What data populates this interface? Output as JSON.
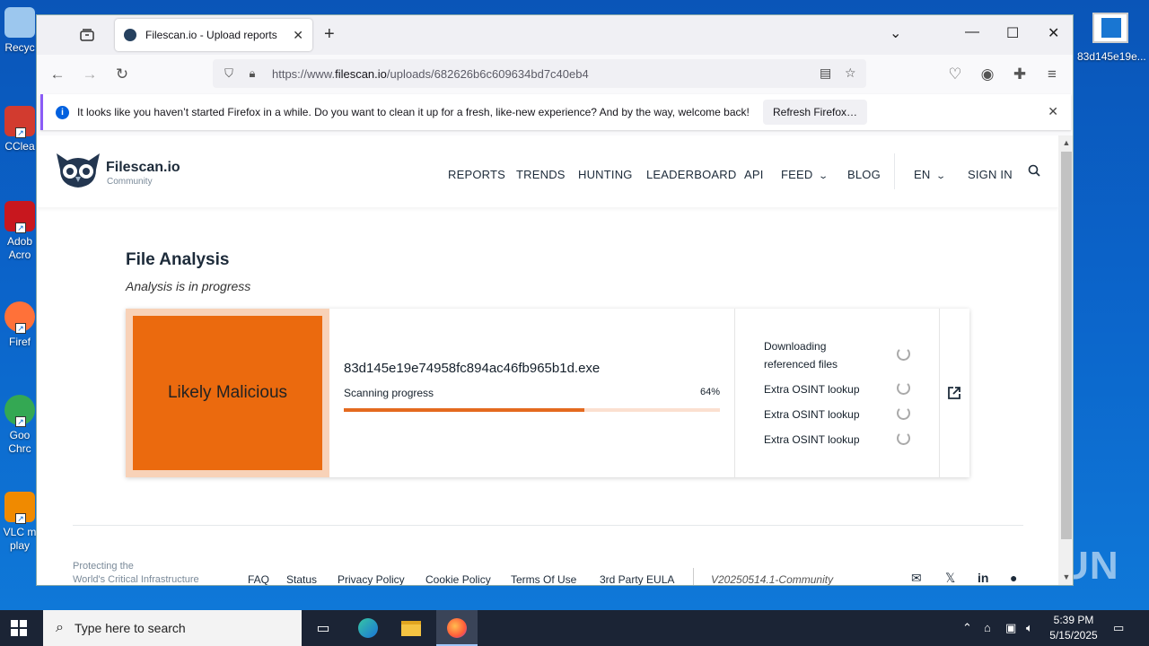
{
  "desktop": {
    "icons": [
      {
        "label": "Recyc",
        "color": "#9cc7ee"
      },
      {
        "label": "CClea",
        "color": "#d23b2f"
      },
      {
        "label": "Adob Acro",
        "color": "#c8171e"
      },
      {
        "label": "Firef",
        "color": "#ff7139"
      },
      {
        "label": "Goo Chrc",
        "color": "#34a853"
      },
      {
        "label": "VLC m play",
        "color": "#f08a00"
      }
    ],
    "right_icon_label": "83d145e19e..."
  },
  "browser": {
    "tab_title": "Filescan.io - Upload reports",
    "url_prefix": "https://www.",
    "url_domain": "filescan.io",
    "url_path": "/uploads/682626b6c609634bd7c40eb4",
    "notice_text": "It looks like you haven’t started Firefox in a while. Do you want to clean it up for a fresh, like-new experience? And by the way, welcome back!",
    "notice_button": "Refresh Firefox…"
  },
  "site": {
    "brand": "Filescan.io",
    "brand_sub": "Community",
    "menu": [
      "REPORTS",
      "TRENDS",
      "HUNTING",
      "LEADERBOARD",
      "API",
      "FEED",
      "BLOG"
    ],
    "lang": "EN",
    "signin": "SIGN IN"
  },
  "analysis": {
    "title": "File Analysis",
    "subtitle": "Analysis is in progress",
    "verdict": "Likely Malicious",
    "verdict_color": "#eb6a0e",
    "file_name": "83d145e19e74958fc894ac46fb965b1d.exe",
    "progress_label": "Scanning progress",
    "progress_text": "64%",
    "progress_value": 0.64,
    "tasks": [
      {
        "line1": "Downloading",
        "line2": "referenced files"
      },
      {
        "line1": "Extra OSINT lookup"
      },
      {
        "line1": "Extra OSINT lookup"
      },
      {
        "line1": "Extra OSINT lookup"
      }
    ]
  },
  "footer": {
    "tagline_1": "Protecting the",
    "tagline_2": "World's Critical Infrastructure",
    "links": [
      "FAQ",
      "Status",
      "Privacy Policy",
      "Cookie Policy",
      "Terms Of Use",
      "3rd Party EULA"
    ],
    "version": "V20250514.1-Community"
  },
  "watermark": "ANY RUN",
  "taskbar": {
    "search_placeholder": "Type here to search",
    "time": "5:39 PM",
    "date": "5/15/2025"
  }
}
